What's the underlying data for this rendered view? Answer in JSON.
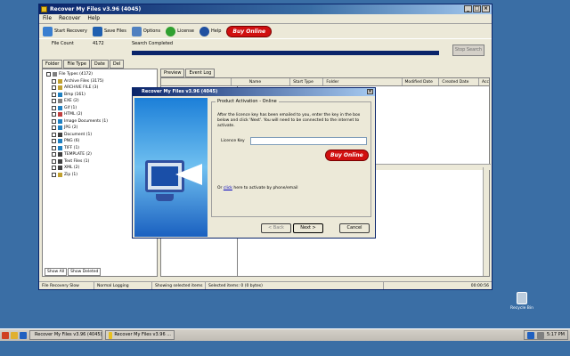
{
  "window": {
    "title": "Recover My Files v3.96 (4045)",
    "menu": [
      "File",
      "Recover",
      "Help"
    ],
    "toolbar": [
      {
        "label": "Start Recovery",
        "icon": "start-icon",
        "color": "#3a7fd0"
      },
      {
        "label": "Save Files",
        "icon": "save-icon",
        "color": "#2060b0"
      },
      {
        "label": "Options",
        "icon": "options-icon",
        "color": "#5080c0"
      },
      {
        "label": "License",
        "icon": "license-icon",
        "color": "#30a030"
      },
      {
        "label": "Help",
        "icon": "help-icon",
        "color": "#2050a0"
      }
    ],
    "buy_label": "Buy Online",
    "status_left": "File Count",
    "status_count": "4172",
    "status_text": "Search Completed",
    "stop_label": "Stop Search",
    "left_tabs": [
      "Folder",
      "File Type",
      "Date",
      "Del"
    ],
    "tree": [
      {
        "label": "File Types (4172)",
        "color": "#808080"
      },
      {
        "label": "Archive Files (3175)",
        "color": "#c0a030"
      },
      {
        "label": "ARCHIVE FILE (3)",
        "color": "#c0a030"
      },
      {
        "label": "Bmp (161)",
        "color": "#2080c0"
      },
      {
        "label": "EXE (2)",
        "color": "#808080"
      },
      {
        "label": "Gif (1)",
        "color": "#2080c0"
      },
      {
        "label": "HTML (2)",
        "color": "#c04040"
      },
      {
        "label": "Image Documents (1)",
        "color": "#2080c0"
      },
      {
        "label": "JPG (2)",
        "color": "#2080c0"
      },
      {
        "label": "Document (1)",
        "color": "#404040"
      },
      {
        "label": "PNG (6)",
        "color": "#2080c0"
      },
      {
        "label": "TIFF (1)",
        "color": "#2080c0"
      },
      {
        "label": "TEMPLATE (2)",
        "color": "#404040"
      },
      {
        "label": "Text Files (1)",
        "color": "#404040"
      },
      {
        "label": "XML (2)",
        "color": "#404040"
      },
      {
        "label": "Zip (1)",
        "color": "#c0a030"
      }
    ],
    "bottom_tabs": [
      "Show All",
      "Show Deleted"
    ],
    "right_tabs": [
      "Preview",
      "Event Log"
    ],
    "columns": [
      "Name",
      "Start Type",
      "Folder",
      "Modified Date",
      "Created Date",
      "Acc"
    ],
    "statusbar": [
      "File Recovery Slow",
      "Normal Logging",
      "Showing selected items",
      "Selected items: 0 (0 bytes)",
      "00:00:56"
    ]
  },
  "dialog": {
    "title": "Recover My Files v3.96 (4045)",
    "group_label": "Product Activation - Online",
    "instructions": "After the licence key has been emailed to you, enter the key in the box below and click 'Next'. You will need to be connected to the internet to activate.",
    "key_label": "Licence Key",
    "key_value": "",
    "buy_label": "Buy Online",
    "or_prefix": "Or",
    "or_link": "click",
    "or_suffix": "here to activate by phone/email",
    "back_label": "< Back",
    "next_label": "Next >",
    "cancel_label": "Cancel"
  },
  "taskbar": {
    "items": [
      "Recover My Files v3.96 (4045)",
      "Recover My Files v3.96 ..."
    ],
    "clock": "5:17 PM"
  },
  "desktop_icon": "Recycle Bin"
}
